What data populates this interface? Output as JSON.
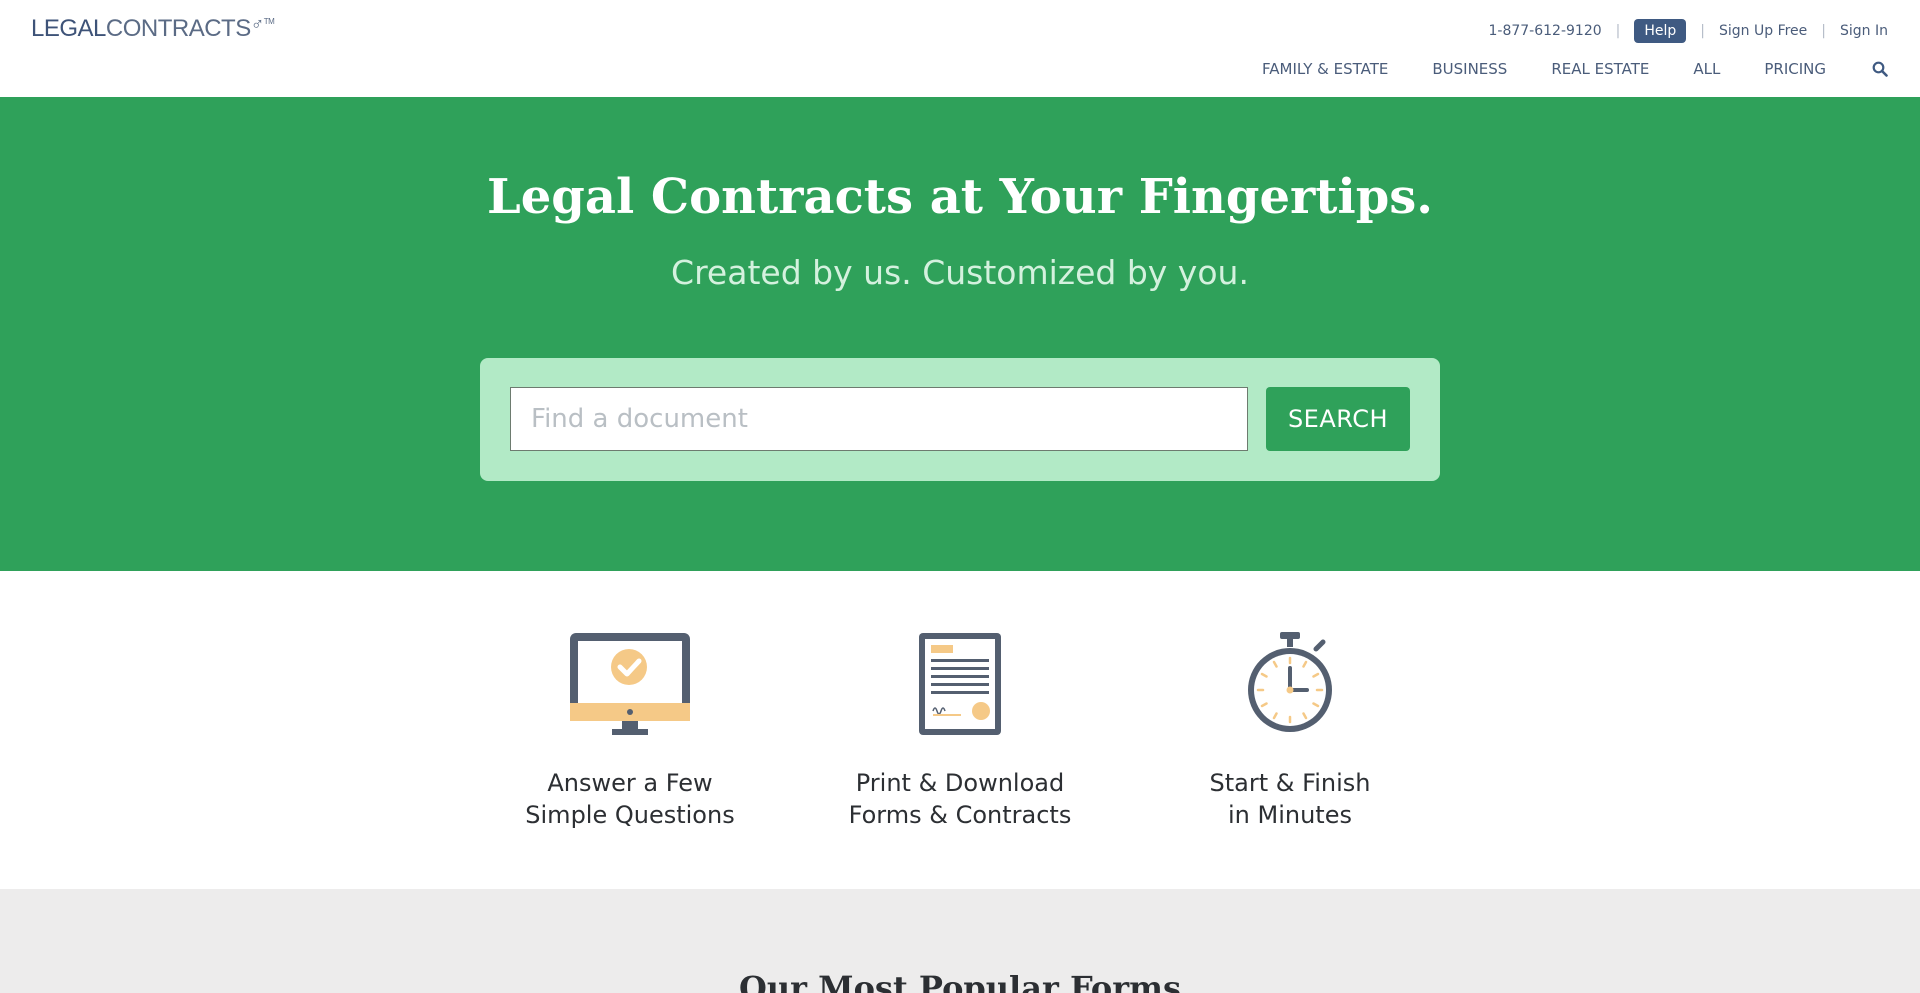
{
  "header": {
    "logo": {
      "part1": "LEGAL",
      "part2": "CONTRACTS",
      "mark": "♂",
      "tm": "TM"
    },
    "utility": {
      "phone": "1-877-612-9120",
      "help": "Help",
      "signup": "Sign Up Free",
      "signin": "Sign In",
      "separator": "|"
    },
    "nav": [
      "FAMILY & ESTATE",
      "BUSINESS",
      "REAL ESTATE",
      "ALL",
      "PRICING"
    ]
  },
  "hero": {
    "title": "Legal Contracts at Your Fingertips.",
    "subtitle": "Created by us. Customized by you.",
    "search": {
      "placeholder": "Find a document",
      "button": "SEARCH"
    }
  },
  "features": [
    {
      "line1": "Answer a Few",
      "line2": "Simple Questions",
      "icon": "monitor-check-icon"
    },
    {
      "line1": "Print & Download",
      "line2": "Forms & Contracts",
      "icon": "document-icon"
    },
    {
      "line1": "Start & Finish",
      "line2": "in Minutes",
      "icon": "stopwatch-icon"
    }
  ],
  "popular": {
    "title": "Our Most Popular Forms"
  },
  "colors": {
    "brand_green": "#2fa15a",
    "panel_green": "#b2eac6",
    "navy": "#3f5a82",
    "accent_yellow": "#f5c987",
    "icon_gray": "#545f70"
  }
}
